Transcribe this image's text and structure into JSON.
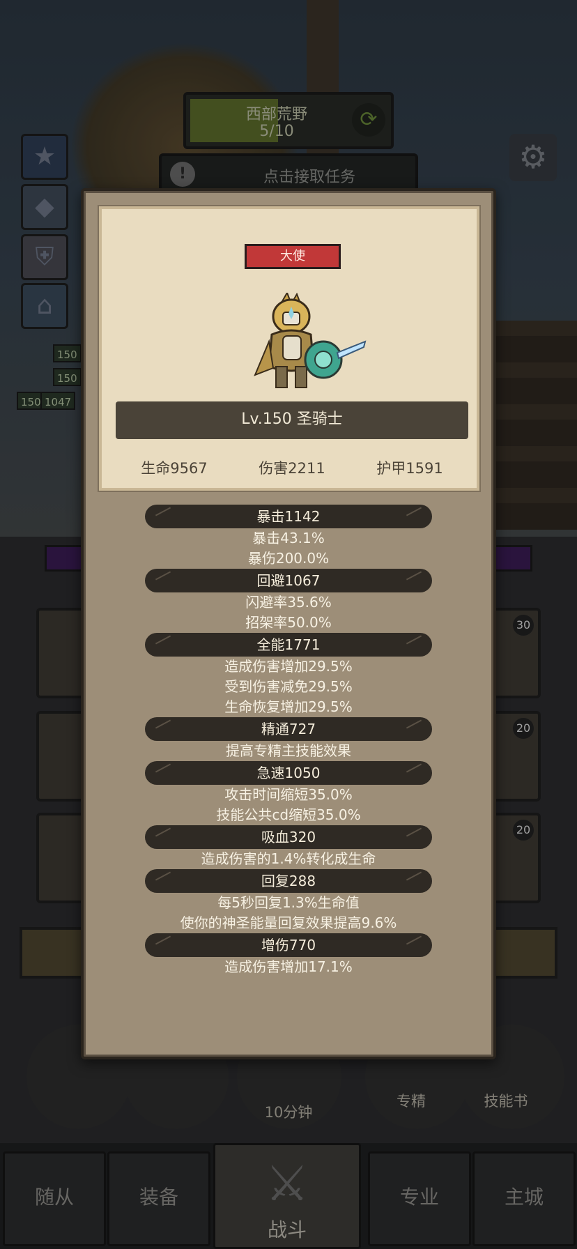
{
  "hud": {
    "location_name": "西部荒野",
    "location_progress": "5/10",
    "task_label": "点击接取任务",
    "side_levels": [
      "150",
      "150",
      "150",
      "1047"
    ]
  },
  "hero": {
    "rank": "大使",
    "level_title": "Lv.150 圣骑士",
    "core_stats": [
      {
        "label": "生命9567"
      },
      {
        "label": "伤害2211"
      },
      {
        "label": "护甲1591"
      }
    ]
  },
  "stat_groups": [
    {
      "header": "暴击1142",
      "lines": [
        "暴击43.1%",
        "暴伤200.0%"
      ]
    },
    {
      "header": "回避1067",
      "lines": [
        "闪避率35.6%",
        "招架率50.0%"
      ]
    },
    {
      "header": "全能1771",
      "lines": [
        "造成伤害增加29.5%",
        "受到伤害减免29.5%",
        "生命恢复增加29.5%"
      ]
    },
    {
      "header": "精通727",
      "lines": [
        "提高专精主技能效果"
      ]
    },
    {
      "header": "急速1050",
      "lines": [
        "攻击时间缩短35.0%",
        "技能公共cd缩短35.0%"
      ]
    },
    {
      "header": "吸血320",
      "lines": [
        "造成伤害的1.4%转化成生命"
      ]
    },
    {
      "header": "回复288",
      "lines": [
        "每5秒回复1.3%生命值",
        "使你的神圣能量回复效果提高9.6%"
      ]
    },
    {
      "header": "增伤770",
      "lines": [
        "造成伤害增加17.1%"
      ]
    }
  ],
  "background": {
    "card_badges": [
      "30",
      "20",
      "20"
    ],
    "timer_label": "10分钟",
    "specialty_label": "专精",
    "skillbook_label": "技能书"
  },
  "tabs": {
    "followers": "随从",
    "equipment": "装备",
    "battle": "战斗",
    "specialty": "专业",
    "main_city": "主城"
  },
  "icons": {
    "refresh": "refresh-icon",
    "settings": "gear-icon",
    "alert": "alert-icon",
    "battle": "crossed-swords-icon"
  },
  "colors": {
    "modal_bg": "#9d8e78",
    "panel_bg": "#e9dcc0",
    "rank_badge": "#c13838",
    "stat_header": "#2f2a24"
  }
}
